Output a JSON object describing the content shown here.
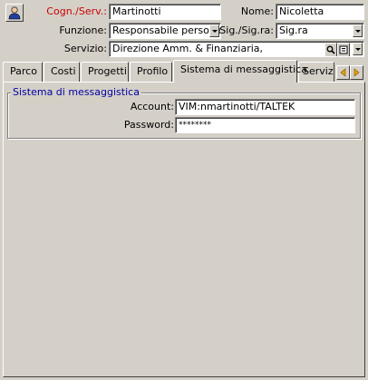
{
  "header": {
    "cogn_label": "Cogn./Serv.:",
    "cogn_value": "Martinotti",
    "nome_label": "Nome:",
    "nome_value": "Nicoletta",
    "funzione_label": "Funzione:",
    "funzione_value": "Responsabile personale",
    "sig_label": "Sig./Sig.ra:",
    "sig_value": "Sig.ra",
    "servizio_label": "Servizio:",
    "servizio_value": "Direzione Amm. & Finanziaria,"
  },
  "tabs": [
    {
      "label": "Parco"
    },
    {
      "label": "Costi"
    },
    {
      "label": "Progetti"
    },
    {
      "label": "Profilo"
    },
    {
      "label": "Sistema di messaggistica"
    },
    {
      "label": "Serviz"
    }
  ],
  "group": {
    "title": "Sistema di messaggistica",
    "account_label": "Account:",
    "account_value": "VIM:nmartinotti/TALTEK",
    "password_label": "Password:",
    "password_value": "********"
  },
  "colors": {
    "background": "#d4d0c8",
    "required_label": "#cc0000",
    "group_title": "#0000a0",
    "arrow": "#e8a000"
  }
}
